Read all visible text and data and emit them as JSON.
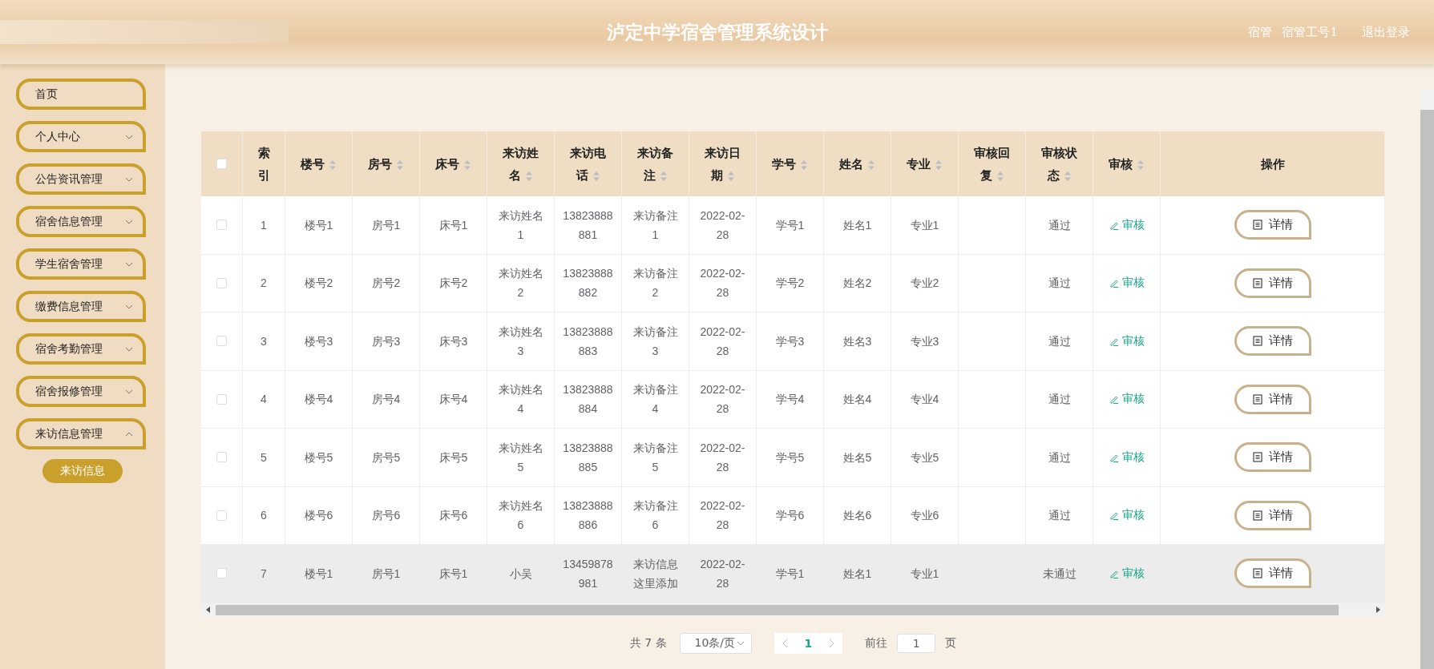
{
  "header": {
    "title": "泸定中学宿舍管理系统设计",
    "role": "宿管",
    "user": "宿管工号1",
    "logout": "退出登录"
  },
  "sidebar": {
    "items": [
      {
        "label": "首页",
        "expandable": false
      },
      {
        "label": "个人中心",
        "expandable": true,
        "expanded": false
      },
      {
        "label": "公告资讯管理",
        "expandable": true,
        "expanded": false
      },
      {
        "label": "宿舍信息管理",
        "expandable": true,
        "expanded": false
      },
      {
        "label": "学生宿舍管理",
        "expandable": true,
        "expanded": false
      },
      {
        "label": "缴费信息管理",
        "expandable": true,
        "expanded": false
      },
      {
        "label": "宿舍考勤管理",
        "expandable": true,
        "expanded": false
      },
      {
        "label": "宿舍报修管理",
        "expandable": true,
        "expanded": false
      },
      {
        "label": "来访信息管理",
        "expandable": true,
        "expanded": true,
        "children": [
          {
            "label": "来访信息",
            "selected": true
          }
        ]
      }
    ]
  },
  "table": {
    "select_all_checked": false,
    "columns": [
      {
        "label": "索引",
        "sortable": false
      },
      {
        "label": "楼号",
        "sortable": true
      },
      {
        "label": "房号",
        "sortable": true
      },
      {
        "label": "床号",
        "sortable": true
      },
      {
        "label": "来访姓名",
        "sortable": true
      },
      {
        "label": "来访电话",
        "sortable": true
      },
      {
        "label": "来访备注",
        "sortable": true
      },
      {
        "label": "来访日期",
        "sortable": true
      },
      {
        "label": "学号",
        "sortable": true
      },
      {
        "label": "姓名",
        "sortable": true
      },
      {
        "label": "专业",
        "sortable": true
      },
      {
        "label": "审核回复",
        "sortable": true
      },
      {
        "label": "审核状态",
        "sortable": true
      },
      {
        "label": "审核",
        "sortable": true
      },
      {
        "label": "操作",
        "sortable": false
      }
    ],
    "rows": [
      {
        "checked": false,
        "highlighted": false,
        "cells": [
          "1",
          "楼号1",
          "房号1",
          "床号1",
          "来访姓名1",
          "13823888881",
          "来访备注1",
          "2022-02-28",
          "学号1",
          "姓名1",
          "专业1",
          "",
          "通过"
        ],
        "audit": "审核",
        "action": "详情"
      },
      {
        "checked": false,
        "highlighted": false,
        "cells": [
          "2",
          "楼号2",
          "房号2",
          "床号2",
          "来访姓名2",
          "13823888882",
          "来访备注2",
          "2022-02-28",
          "学号2",
          "姓名2",
          "专业2",
          "",
          "通过"
        ],
        "audit": "审核",
        "action": "详情"
      },
      {
        "checked": false,
        "highlighted": false,
        "cells": [
          "3",
          "楼号3",
          "房号3",
          "床号3",
          "来访姓名3",
          "13823888883",
          "来访备注3",
          "2022-02-28",
          "学号3",
          "姓名3",
          "专业3",
          "",
          "通过"
        ],
        "audit": "审核",
        "action": "详情"
      },
      {
        "checked": false,
        "highlighted": false,
        "cells": [
          "4",
          "楼号4",
          "房号4",
          "床号4",
          "来访姓名4",
          "13823888884",
          "来访备注4",
          "2022-02-28",
          "学号4",
          "姓名4",
          "专业4",
          "",
          "通过"
        ],
        "audit": "审核",
        "action": "详情"
      },
      {
        "checked": false,
        "highlighted": false,
        "cells": [
          "5",
          "楼号5",
          "房号5",
          "床号5",
          "来访姓名5",
          "13823888885",
          "来访备注5",
          "2022-02-28",
          "学号5",
          "姓名5",
          "专业5",
          "",
          "通过"
        ],
        "audit": "审核",
        "action": "详情"
      },
      {
        "checked": false,
        "highlighted": false,
        "cells": [
          "6",
          "楼号6",
          "房号6",
          "床号6",
          "来访姓名6",
          "13823888886",
          "来访备注6",
          "2022-02-28",
          "学号6",
          "姓名6",
          "专业6",
          "",
          "通过"
        ],
        "audit": "审核",
        "action": "详情"
      },
      {
        "checked": false,
        "highlighted": true,
        "cells": [
          "7",
          "楼号1",
          "房号1",
          "床号1",
          "小吴",
          "13459878981",
          "来访信息这里添加",
          "2022-02-28",
          "学号1",
          "姓名1",
          "专业1",
          "",
          "未通过"
        ],
        "audit": "审核",
        "action": "详情"
      }
    ]
  },
  "pagination": {
    "total": "共 7 条",
    "page_size": "10条/页",
    "pages": [
      {
        "label": "1",
        "selected": true
      }
    ],
    "goto_label": "前往",
    "goto_value": "1",
    "goto_suffix": "页"
  }
}
